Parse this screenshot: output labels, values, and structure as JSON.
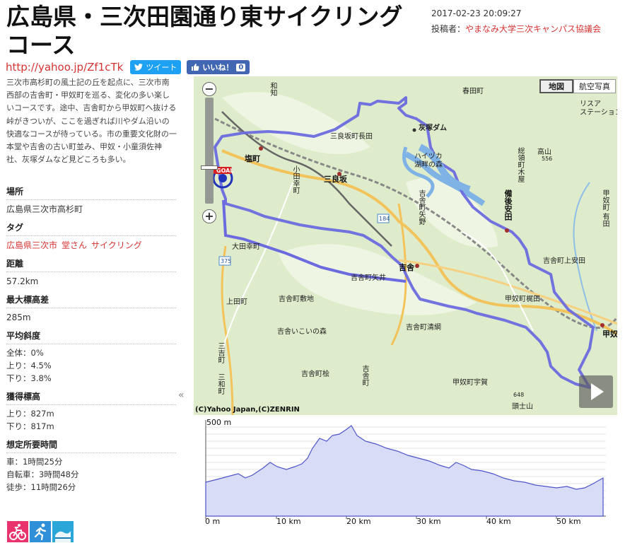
{
  "page": {
    "title": "広島県・三次田園通り東サイクリングコース",
    "datetime": "2017-02-23 20:09:27",
    "poster_label": "投稿者：",
    "poster_name": "やまなみ大学三次キャンパス協議会",
    "short_url": "http://yahoo.jp/Zf1cTk",
    "tweet_label": "ツイート",
    "like_label": "いいね！",
    "like_count": "0"
  },
  "sidebar": {
    "description": "三次市高杉町の風土記の丘を起点に、三次市南西部の吉舎町・甲奴町を巡る、変化の多い楽しいコースです。途中、吉舎町から甲奴町へ抜ける峠がきついが、ここを過ぎれば川やダム沿いの快適なコースが待っている。市の重要文化財の一本堂や吉舎の古い町並み、甲奴・小童須佐神社、灰塚ダムなど見どころも多い。",
    "location_title": "場所",
    "location": "広島県三次市高杉町",
    "tags_title": "タグ",
    "tags": [
      "広島県三次市",
      "堂さん",
      "サイクリング"
    ],
    "distance_title": "距離",
    "distance": "57.2km",
    "max_elev_diff_title": "最大標高差",
    "max_elev_diff": "285m",
    "avg_grade_title": "平均斜度",
    "avg_grade": {
      "all": "全体：0%",
      "up": "上り：4.5%",
      "down": "下り：3.8%"
    },
    "elev_gain_title": "獲得標高",
    "elev_gain": {
      "up": "上り：827m",
      "down": "下り：817m"
    },
    "time_title": "想定所要時間",
    "time": {
      "car": "車：1時間25分",
      "bike": "自転車：3時間48分",
      "walk": "徒歩：11時間26分"
    },
    "collapse_glyph": "«"
  },
  "map": {
    "tab_map": "地図",
    "tab_photo": "航空写真",
    "copyright": "(C)Yahoo Japan,(C)ZENRIN",
    "zoom_in": "+",
    "zoom_out": "−",
    "goal_badge": "GOAL",
    "route_color": "#6b6bdf",
    "labels": {
      "haruta": "春田町",
      "wachi": "和知",
      "haizuka_dam": "灰塚ダム",
      "riverstation": "リスア\nステーション",
      "sanraozakase": "三良坂町長田",
      "shiomachi": "塩町",
      "haizu": "ハイヅカ\n湖畔の森",
      "takayama": "高山",
      "takayama_no": "556",
      "sanrazaka": "三良坂",
      "odamachi": "小田幸町",
      "soryo": "総領町木屋",
      "bingo_yasuda": "備後安田",
      "route184": "184",
      "kisayano": "吉舎町矢野",
      "kounu_arita": "甲奴町\n有田",
      "ota_kocho": "大田幸町",
      "kisa": "吉舎",
      "kisa_kamiyasuda": "吉舎町上安田",
      "kisa_yai": "吉舎町矢井",
      "route375": "375",
      "kisa_shikiji": "吉舎町敷地",
      "kounu_kajita": "甲奴町梶田",
      "kamida": "上田町",
      "kisa_ikoi": "吉舎いこいの森",
      "kisa_kiyoshiki": "吉舎町清綱",
      "kounu": "甲奴",
      "miyoshi": "三吉町",
      "kisa_hi": "吉舎町桧",
      "kisa_sm": "吉舎町",
      "miwa": "三和町",
      "kounu_uga": "甲奴町宇賀",
      "tosan": "頭士山",
      "tosan_no": "648",
      "haizu2": "灰塚"
    }
  },
  "elevation": {
    "y_label": "500 m",
    "x_labels": [
      "0 m",
      "10 km",
      "20 km",
      "30 km",
      "40 km",
      "50 km"
    ]
  }
}
